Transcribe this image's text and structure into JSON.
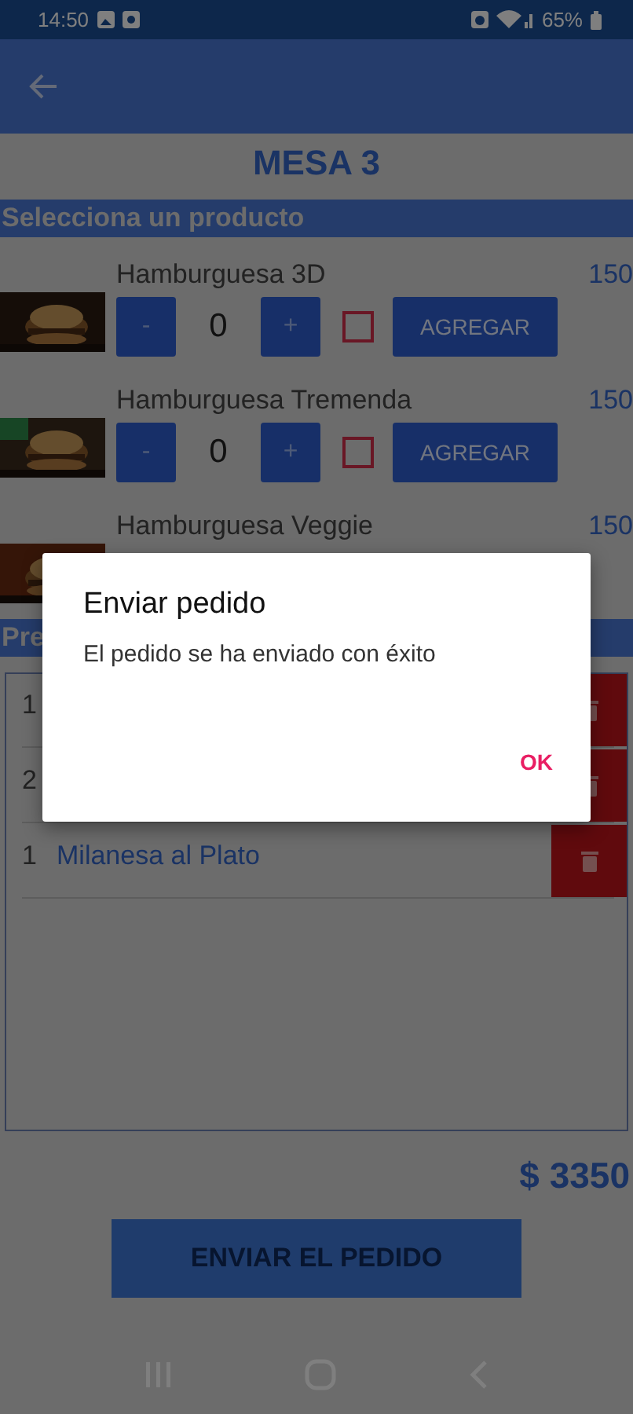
{
  "status_bar": {
    "time": "14:50",
    "battery": "65%"
  },
  "title": "MESA 3",
  "products_header": "Selecciona un producto",
  "products": [
    {
      "name": "Hamburguesa 3D",
      "price": "150",
      "quantity": "0",
      "minus": "-",
      "plus": "+",
      "checked": false,
      "add_label": "AGREGAR"
    },
    {
      "name": "Hamburguesa Tremenda",
      "price": "150",
      "quantity": "0",
      "minus": "-",
      "plus": "+",
      "checked": false,
      "add_label": "AGREGAR"
    },
    {
      "name": "Hamburguesa Veggie",
      "price": "150"
    }
  ],
  "order_header": "Pre",
  "order_items": [
    {
      "quantity": "1"
    },
    {
      "quantity": "2"
    },
    {
      "quantity": "1",
      "name": "Milanesa al Plato"
    }
  ],
  "total": "$ 3350",
  "send_button": "ENVIAR EL PEDIDO",
  "dialog": {
    "title": "Enviar pedido",
    "message": "El pedido se ha enviado con éxito",
    "button": "OK"
  }
}
